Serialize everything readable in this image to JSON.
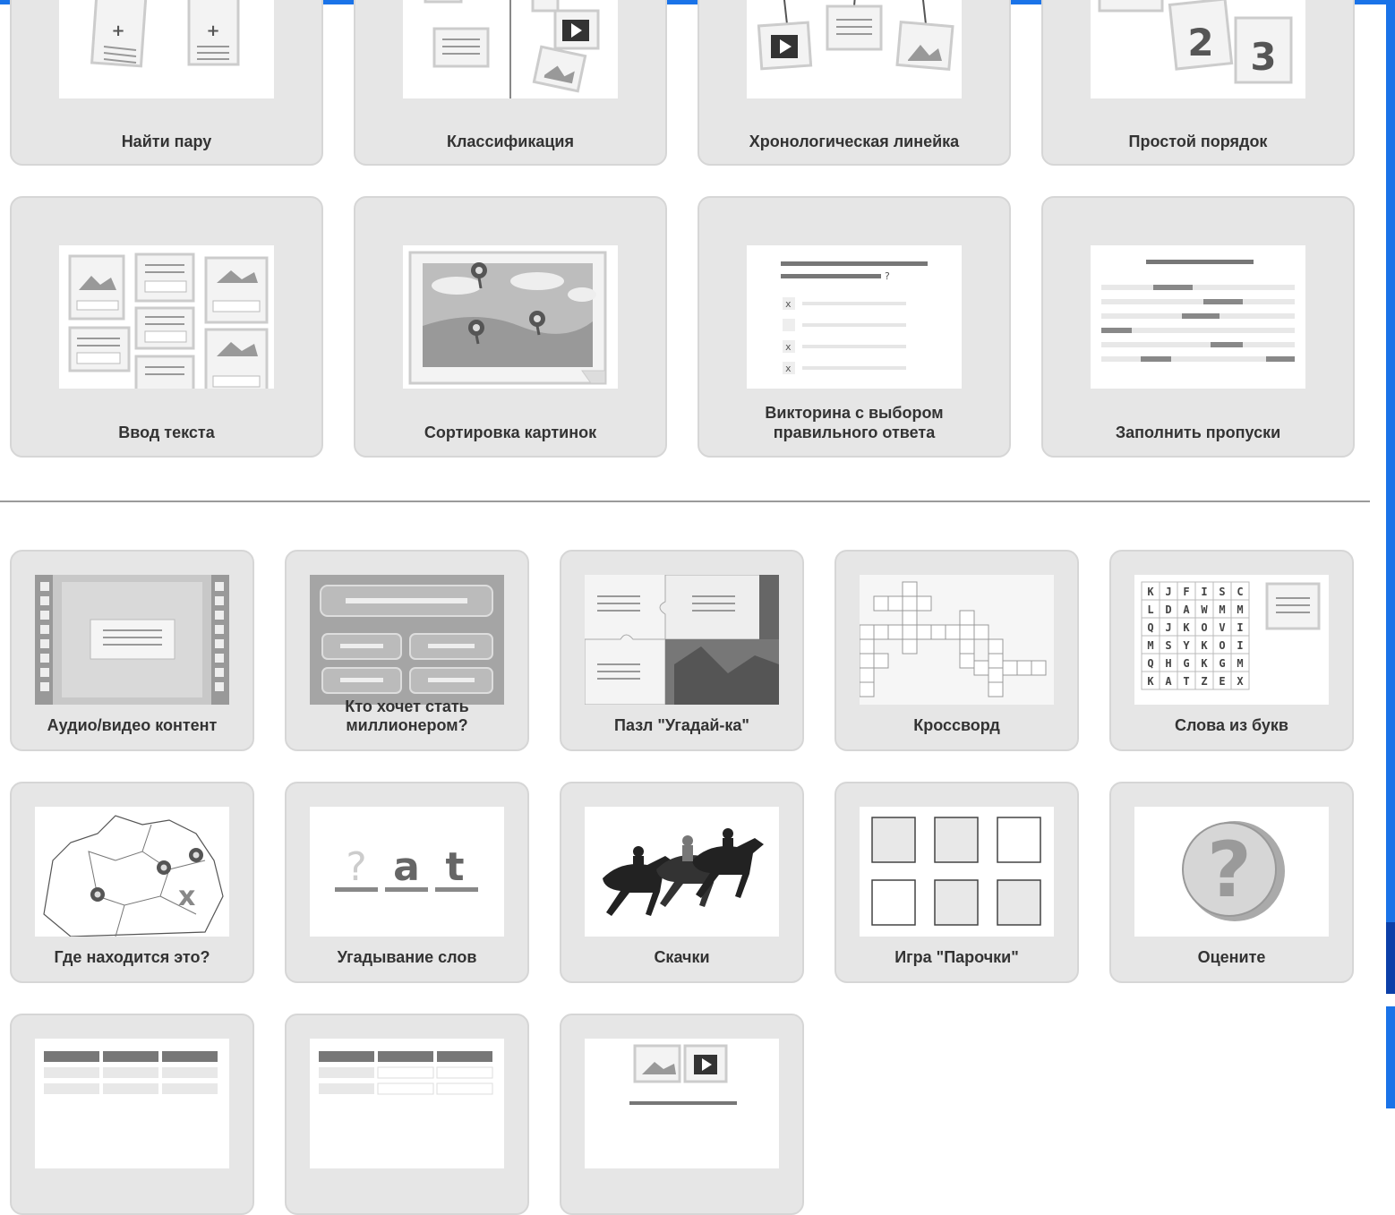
{
  "templates_primary": [
    {
      "label": "Найти пару",
      "icon": "find-pair-thumbnail"
    },
    {
      "label": "Классификация",
      "icon": "classification-thumbnail"
    },
    {
      "label": "Хронологическая линейка",
      "icon": "timeline-thumbnail"
    },
    {
      "label": "Простой порядок",
      "icon": "simple-order-thumbnail"
    },
    {
      "label": "Ввод текста",
      "icon": "text-input-thumbnail"
    },
    {
      "label": "Сортировка картинок",
      "icon": "picture-sorting-thumbnail"
    },
    {
      "label_line1": "Викторина с выбором",
      "label_line2": "правильного ответа",
      "icon": "multiple-choice-quiz-thumbnail"
    },
    {
      "label": "Заполнить пропуски",
      "icon": "fill-gaps-thumbnail"
    }
  ],
  "templates_games": [
    {
      "label": "Аудио/видео контент",
      "icon": "audio-video-thumbnail"
    },
    {
      "label_line1": "Кто хочет стать",
      "label_line2": "миллионером?",
      "icon": "millionaire-thumbnail"
    },
    {
      "label": "Пазл \"Угадай-ка\"",
      "icon": "puzzle-thumbnail"
    },
    {
      "label": "Кроссворд",
      "icon": "crossword-thumbnail"
    },
    {
      "label": "Слова из букв",
      "icon": "word-grid-thumbnail"
    },
    {
      "label": "Где находится это?",
      "icon": "where-is-it-map-thumbnail"
    },
    {
      "label": "Угадывание слов",
      "icon": "word-guess-thumbnail"
    },
    {
      "label": "Скачки",
      "icon": "horse-race-thumbnail"
    },
    {
      "label": "Игра \"Парочки\"",
      "icon": "pairs-game-thumbnail"
    },
    {
      "label": "Оцените",
      "icon": "rate-question-thumbnail"
    }
  ],
  "word_grid_letters": [
    [
      "K",
      "J",
      "F",
      "I",
      "S",
      "C"
    ],
    [
      "L",
      "D",
      "A",
      "W",
      "M",
      "M"
    ],
    [
      "Q",
      "J",
      "K",
      "O",
      "V",
      "I"
    ],
    [
      "M",
      "S",
      "Y",
      "K",
      "O",
      "I"
    ],
    [
      "Q",
      "H",
      "G",
      "K",
      "G",
      "M"
    ],
    [
      "K",
      "A",
      "T",
      "Z",
      "E",
      "X"
    ]
  ],
  "word_guess": {
    "q": "?",
    "a": "a",
    "t": "t"
  },
  "order_numbers": {
    "two": "2",
    "three": "3"
  },
  "rate_symbol": "?",
  "colors": {
    "accent": "#1a73e8",
    "tile_bg": "#e6e6e6",
    "tile_border": "#d6d6d6",
    "label": "#333333"
  }
}
